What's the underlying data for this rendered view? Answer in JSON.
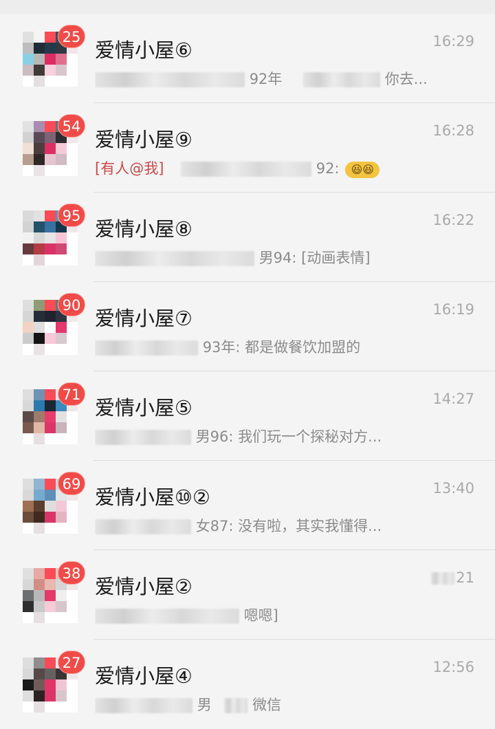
{
  "colors": {
    "background": "#ededed",
    "row": "#f4f4f4",
    "badge": "#f04b48",
    "time": "#a9a9a9",
    "preview": "#8b8b8b",
    "mention": "#c84a48"
  },
  "chats": [
    {
      "title": "爱情小屋⑥",
      "time": "16:29",
      "badge": "25",
      "preview": "92年",
      "preview_suffix": "你去...",
      "avatar_colors": [
        "#e0e0e0",
        "#f4f4f4",
        "#fb4b57",
        "#3f4c56",
        "#ffffff",
        "#bdbdbd",
        "#1f2c38",
        "#243a4b",
        "#2e3944",
        "#f1e4ea",
        "#8ad0e5",
        "#b8b8b8",
        "#de2c63",
        "#e06f8e",
        "#ffffff",
        "#cbbcc2",
        "#3e3b39",
        "#f7cfdd",
        "#d9c5cc",
        "#ffffff",
        "#ffffff",
        "#e5dfe1",
        "#ffffff",
        "#ffffff",
        "#ffffff"
      ]
    },
    {
      "title": "爱情小屋⑨",
      "time": "16:28",
      "badge": "54",
      "mention": "[有人@我]",
      "preview": "92:",
      "emoji": "😆😆",
      "avatar_colors": [
        "#e2e2e2",
        "#a98db0",
        "#fb4b57",
        "#6b6b75",
        "#ffffff",
        "#d2d2d2",
        "#5a4a58",
        "#7d6375",
        "#2e2c31",
        "#efe7ea",
        "#f0e0d6",
        "#4c3e3d",
        "#dc2f64",
        "#f6c9d7",
        "#ffffff",
        "#b89e8f",
        "#2d2825",
        "#e7c5d0",
        "#d1bac3",
        "#ffffff",
        "#ffffff",
        "#e9e3e5",
        "#ffffff",
        "#ffffff",
        "#ffffff"
      ]
    },
    {
      "title": "爱情小屋⑧",
      "time": "16:22",
      "badge": "95",
      "preview": "男94: [动画表情]",
      "avatar_colors": [
        "#dadada",
        "#e2e2e2",
        "#fb4b57",
        "#6b8fa8",
        "#ffffff",
        "#d3d3d3",
        "#24506b",
        "#3572a1",
        "#15364d",
        "#f0e7e9",
        "#f2f2f2",
        "#d8d8d8",
        "#e6e6e6",
        "#f7c5d5",
        "#ffffff",
        "#653b3c",
        "#b43c45",
        "#da3268",
        "#d04874",
        "#ffffff",
        "#ffffff",
        "#e3d6da",
        "#ffffff",
        "#ffffff",
        "#ffffff"
      ]
    },
    {
      "title": "爱情小屋⑦",
      "time": "16:19",
      "badge": "90",
      "preview": "93年: 都是做餐饮加盟的",
      "avatar_colors": [
        "#dedede",
        "#8e9c76",
        "#fb4b57",
        "#6d746f",
        "#ffffff",
        "#d6d6d6",
        "#262c38",
        "#1f2330",
        "#2d3341",
        "#f0e8ea",
        "#f2d2c2",
        "#dedede",
        "#ffffff",
        "#e2386b",
        "#ffffff",
        "#cccccc",
        "#141414",
        "#f7c8d8",
        "#d8c9ce",
        "#ffffff",
        "#ffffff",
        "#e8e3e5",
        "#ffffff",
        "#ffffff",
        "#ffffff"
      ]
    },
    {
      "title": "爱情小屋⑤",
      "time": "14:27",
      "badge": "71",
      "preview": "男96: 我们玩一个探秘对方...",
      "avatar_colors": [
        "#dedede",
        "#6b94b4",
        "#fb4b57",
        "#e0e6ea",
        "#ffffff",
        "#d8d8d8",
        "#2a7ab0",
        "#1b2733",
        "#3c8ac0",
        "#f0e7e9",
        "#5a4a48",
        "#9f7b6b",
        "#e93c6a",
        "#e2e2e2",
        "#ffffff",
        "#7a5a50",
        "#e1b7a6",
        "#da3669",
        "#c9b4bb",
        "#ffffff",
        "#ffffff",
        "#e6dfe1",
        "#ffffff",
        "#ffffff",
        "#ffffff"
      ]
    },
    {
      "title": "爱情小屋⑩②",
      "time": "13:40",
      "badge": "69",
      "preview": "女87: 没有啦，其实我懂得...",
      "avatar_colors": [
        "#dedede",
        "#8fb7d2",
        "#fb4b57",
        "#c8d6df",
        "#ffffff",
        "#d8d8d8",
        "#77aacf",
        "#5d8fb8",
        "#e0e6ea",
        "#f0e7e9",
        "#a06f54",
        "#5a3e2e",
        "#dedede",
        "#f4c7d6",
        "#ffffff",
        "#6b4c3b",
        "#3f2a20",
        "#da3569",
        "#e6b3c1",
        "#ffffff",
        "#ffffff",
        "#e6dfe1",
        "#ffffff",
        "#ffffff",
        "#ffffff"
      ]
    },
    {
      "title": "爱情小屋②",
      "time": "21",
      "badge": "38",
      "preview": "嗯嗯]",
      "avatar_colors": [
        "#e0e0e0",
        "#e7a9a4",
        "#fb4b57",
        "#efc0bb",
        "#ffffff",
        "#d7d7d7",
        "#d28e86",
        "#e9b8af",
        "#d6d6d6",
        "#f0e7e9",
        "#6e6f70",
        "#b8b8b8",
        "#e43a69",
        "#efefef",
        "#ffffff",
        "#2e2e2e",
        "#c9c9c9",
        "#f7cbd8",
        "#d7c5cc",
        "#ffffff",
        "#ffffff",
        "#e5dfe1",
        "#ffffff",
        "#ffffff",
        "#ffffff"
      ]
    },
    {
      "title": "爱情小屋④",
      "time": "12:56",
      "badge": "27",
      "preview": "男",
      "preview_suffix": "微信",
      "avatar_colors": [
        "#dedede",
        "#8f8f8f",
        "#fb4b57",
        "#e8e8e8",
        "#ffffff",
        "#d8d8d8",
        "#584949",
        "#676060",
        "#3a3434",
        "#f0e7e9",
        "#1a1a1a",
        "#6f5c58",
        "#e33469",
        "#f0c6d4",
        "#ffffff",
        "#dedede",
        "#2d2222",
        "#db3469",
        "#d9c5cc",
        "#ffffff",
        "#ffffff",
        "#e5dfe1",
        "#ffffff",
        "#ffffff",
        "#ffffff"
      ]
    }
  ]
}
